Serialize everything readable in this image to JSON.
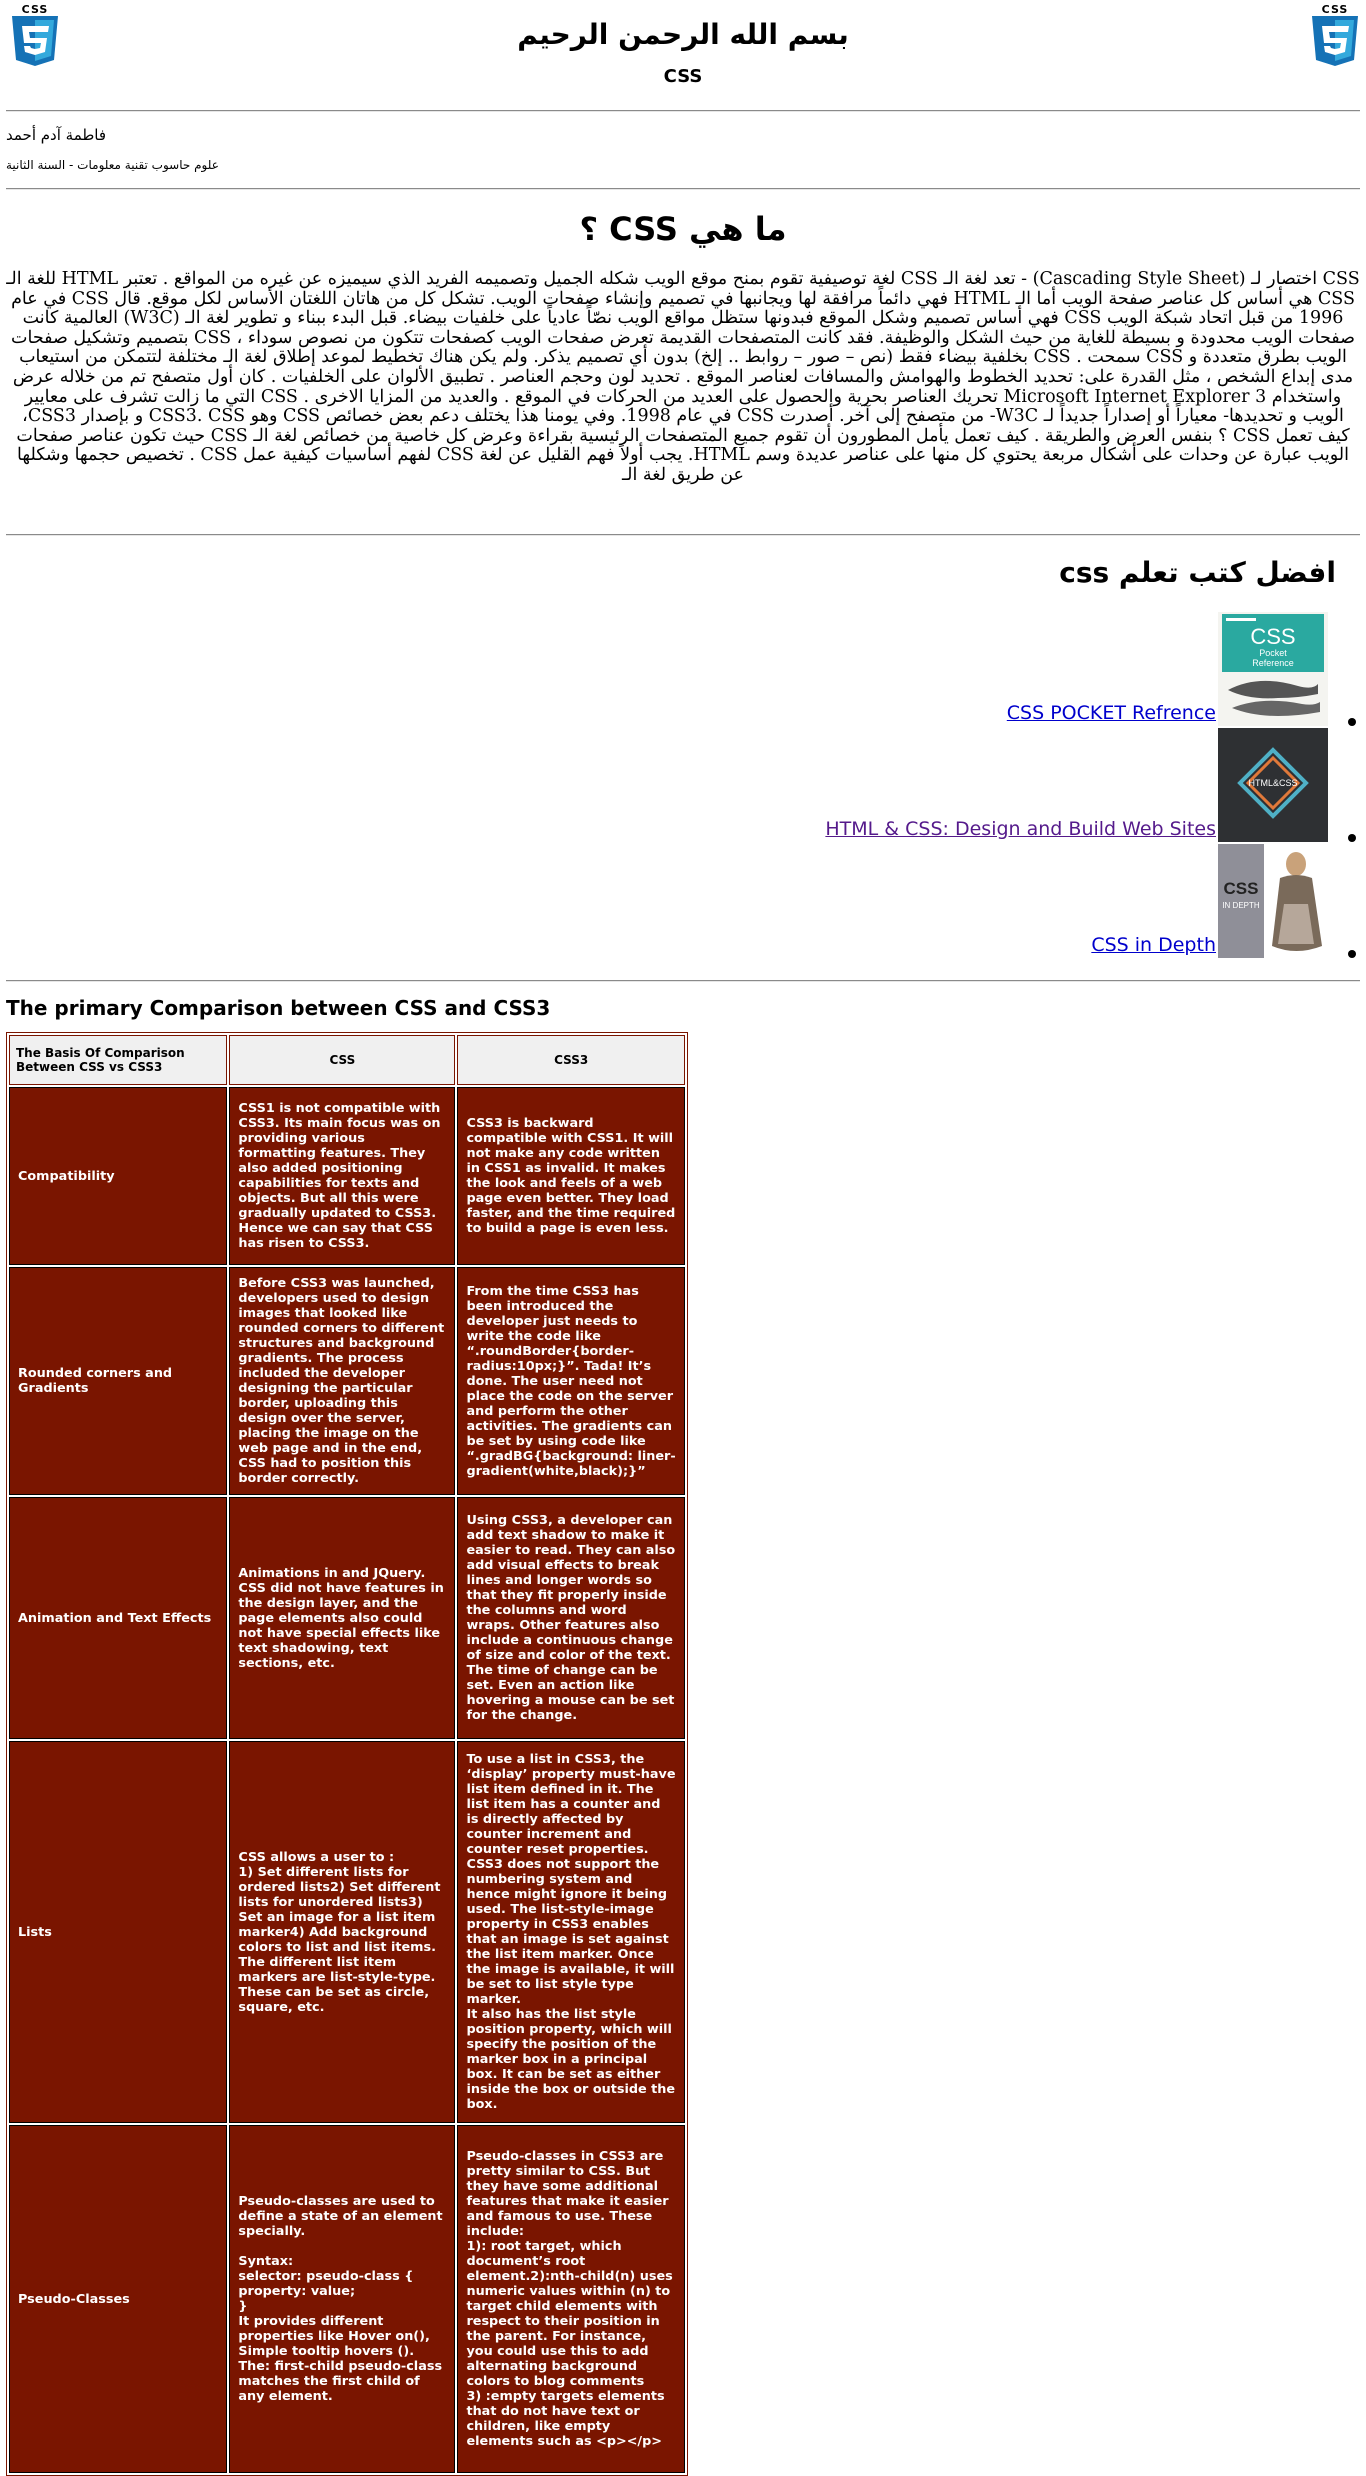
{
  "header": {
    "logo_caption": "CSS",
    "bismillah": "بسم الله الرحمن الرحيم",
    "subtitle": "CSS"
  },
  "author": {
    "name": "فاطمة آدم أحمد",
    "department": "علوم حاسوب تقنية معلومات - السنة الثانية"
  },
  "intro": {
    "heading": "ما هي CSS ؟",
    "paragraph": "CSS اختصار لـ (Cascading Style Sheet) - تعد لغة الـ CSS لغة توصيفية تقوم بمنح موقع الويب شكله الجميل وتصميمه الفريد الذي سيميزه عن غيره من المواقع . تعتبر HTML للغة الـ CSS هي أساس كل عناصر صفحة الويب أما الـ HTML فهي دائماً مرافقة لها ويجانبها في تصميم وإنشاء صفحات الويب. تشكل كل من هاتان اللغتان الأساس لكل موقع. قال CSS في عام 1996 من قبل اتحاد شبكة الويب CSS فهي أساس تصميم وشكل الموقع فبدونها ستظل مواقع الويب نصّاً عادياً على خلفيات بيضاء. قبل البدء ببناء و تطوير لغة الـ (W3C) العالمية كانت صفحات الويب محدودة و بسيطة للغاية من حيث الشكل والوظيفة. فقد كانت المتصفحات القديمة تعرض صفحات الويب كصفحات تتكون من نصوص سوداء ، CSS بتصميم وتشكيل صفحات الويب بطرق متعددة و CSS سمحت . CSS بخلفية بيضاء فقط (نص – صور – روابط .. إلخ) بدون أي تصميم يذكر. ولم يكن هناك تخطيط لموعد إطلاق لغة الـ مختلفة لتتمكن من استيعاب مدى إبداع الشخص ، مثل القدرة على: تحديد الخطوط والهوامش والمسافات لعناصر الموقع . تحديد لون وحجم العناصر . تطبيق الألوان على الخلفيات . كان أول متصفح تم من خلاله عرض واستخدام Microsoft Internet Explorer 3 تحريك العناصر بحرية والحصول على العديد من الحركات في الموقع . والعديد من المزايا الاخرى . CSS التي ما زالت تشرف على معايير الويب و تحديدها- معياراً أو إصداراً جديداً لـ W3C- من متصفح إلى آخر. أصدرت CSS في عام 1998. وفي يومنا هذا يختلف دعم بعض خصائص CSS وهو CSS3. CSS و بإصدار CSS3، كيف تعمل CSS ؟ بنفس العرض والطريقة . كيف تعمل يأمل المطورون أن تقوم جميع المتصفحات الرئيسية بقراءة وعرض كل خاصية من خصائص لغة الـ CSS حيث تكون عناصر صفحات الويب عبارة عن وحدات على أشكال مربعة يحتوي كل منها على عناصر عديدة وسم HTML. يجب أولاً فهم القليل عن لغة CSS لفهم أساسيات كيفية عمل CSS . تخصيص حجمها وشكلها عن طريق لغة الـ"
  },
  "books": {
    "heading": "افضل كتب تعلم css",
    "items": [
      {
        "title": "CSS POCKET Refrence",
        "cover_caption": "CSS Pocket Reference"
      },
      {
        "title": "HTML & CSS: Design and Build Web Sites",
        "cover_caption": "HTML & CSS"
      },
      {
        "title": "CSS in Depth",
        "cover_caption": "CSS IN DEPTH"
      }
    ]
  },
  "comparison": {
    "heading": "The primary Comparison between CSS and CSS3",
    "headers": [
      "The Basis Of Comparison Between CSS vs CSS3",
      "CSS",
      "CSS3"
    ],
    "rows": [
      {
        "basis": "Compatibility",
        "css": "CSS1 is not compatible with CSS3. Its main focus was on providing various formatting features. They also added positioning capabilities for texts and objects. But all this were gradually updated to CSS3. Hence we can say that CSS has risen to CSS3.",
        "css3": "CSS3 is backward compatible with CSS1. It will not make any code written in CSS1 as invalid. It makes the look and feels of a web page even better. They load faster, and the time required to build a page is even less."
      },
      {
        "basis": "Rounded corners and Gradients",
        "css": "Before CSS3 was launched, developers used to design images that looked like rounded corners to different structures and background gradients. The process included the developer designing the particular border, uploading this design over the server, placing the image on the web page and in the end, CSS had to position this border correctly.",
        "css3": "From the time CSS3 has been introduced the developer just needs to write the code like “.roundBorder{border-radius:10px;}”. Tada! It’s done. The user need not place the code on the server and perform the other activities. The gradients can be set by using code like “.gradBG{background: liner-gradient(white,black);}”"
      },
      {
        "basis": "Animation and Text Effects",
        "css": "Animations in and JQuery. CSS did not have features in the design layer, and the page elements also could not have special effects like text shadowing, text sections, etc.",
        "css3": "Using CSS3, a developer can add text shadow to make it easier to read. They can also add visual effects to break lines and longer words so that they fit properly inside the columns and word wraps. Other features also include a continuous change of size and color of the text. The time of change can be set. Even an action like hovering a mouse can be set for the change."
      },
      {
        "basis": "Lists",
        "css": "CSS allows a user to :\n1) Set different lists for ordered lists2) Set different lists for unordered lists3) Set an image for a list item marker4) Add background colors to list and list items. The different list item markers are list-style-type. These can be set as circle, square, etc.",
        "css3": "To use a list in CSS3, the ‘display’ property must-have list item defined in it. The list item has a counter and is directly affected by counter increment and counter reset properties. CSS3 does not support the numbering system and hence might ignore it being used. The list-style-image property in CSS3 enables that an image is set against the list item marker. Once the image is available, it will be set to list style type marker.\nIt also has the list style position property, which will specify the position of the marker box in a principal box. It can be set as either inside the box or outside the box."
      },
      {
        "basis": "Pseudo-Classes",
        "css": "Pseudo-classes are used to define a state of an element specially.\n\nSyntax:\nselector: pseudo-class {\nproperty: value;\n}\nIt provides different properties like Hover on(), Simple tooltip hovers (). The: first-child pseudo-class matches the first child of any element.",
        "css3": "Pseudo-classes in CSS3 are pretty similar to CSS. But they have some additional features that make it easier and famous to use. These include:\n1): root target, which document’s root element.2):nth-child(n) uses numeric values within (n) to target child elements with respect to their position in the parent. For instance, you could use this to add alternating background colors to blog comments\n3) :empty targets elements that do not have text or children, like empty elements such as <p></p>"
      }
    ]
  }
}
